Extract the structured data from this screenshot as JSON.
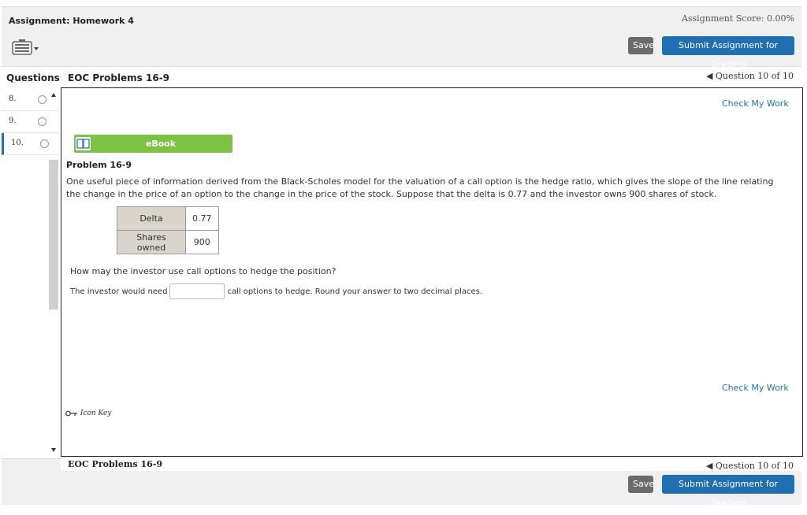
{
  "header": {
    "assignment_title": "Assignment: Homework 4",
    "assignment_score": "Assignment Score: 0.00%",
    "keyboard_icon": "keyboard-icon",
    "save_label": "Save",
    "submit_label": "Submit Assignment for Grading"
  },
  "sidebar": {
    "heading": "Questions",
    "items": [
      {
        "num": "8."
      },
      {
        "num": "9."
      },
      {
        "num": "10."
      }
    ]
  },
  "section": {
    "title": "EOC Problems 16-9",
    "question_nav": "◀ Question 10 of 10"
  },
  "content": {
    "check_work_top": "Check My Work",
    "ebook_label": "eBook",
    "problem_title": "Problem 16-9",
    "problem_text": "One useful piece of information derived from the Black-Scholes model for the valuation of a call option is the hedge ratio, which gives the slope of the line relating the change in the price of an option to the change in the price of the stock. Suppose that the delta is 0.77 and the investor owns 900 shares of stock.",
    "table": [
      {
        "label": "Delta",
        "value": "0.77"
      },
      {
        "label": "Shares owned",
        "value": "900"
      }
    ],
    "question": "How may the investor use call options to hedge the position?",
    "answer_prefix": "The investor would need",
    "answer_value": "",
    "answer_suffix": "call options to hedge. Round your answer to two decimal places.",
    "check_work_bottom": "Check My Work",
    "icon_key": "Icon Key"
  },
  "footer": {
    "title": "EOC Problems 16-9",
    "question_nav": "◀ Question 10 of 10",
    "save_label": "Save",
    "submit_label": "Submit Assignment for Grading"
  },
  "colors": {
    "accent": "#1f6fb2",
    "ebook_green": "#7dc242"
  }
}
